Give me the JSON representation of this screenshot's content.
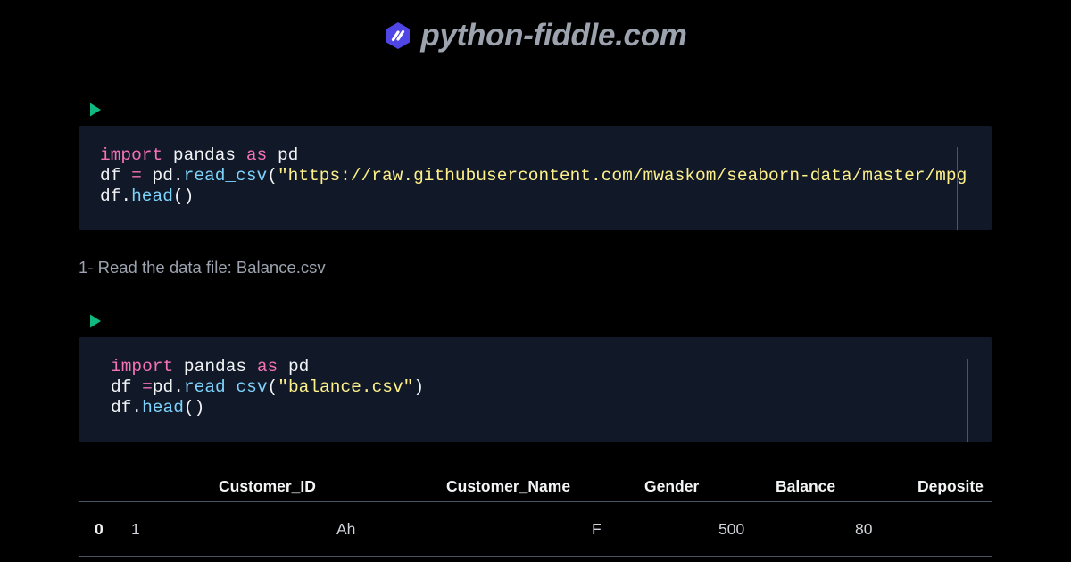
{
  "header": {
    "logo_icon": "python-fiddle-logo-icon",
    "site_name": "python-fiddle.com",
    "logo_color": "#4f46e5"
  },
  "cells": [
    {
      "run_icon": "play-icon",
      "lines": [
        [
          {
            "t": "import",
            "c": "kw"
          },
          {
            "t": " pandas ",
            "c": ""
          },
          {
            "t": "as",
            "c": "kw"
          },
          {
            "t": " pd",
            "c": ""
          }
        ],
        [
          {
            "t": "df ",
            "c": ""
          },
          {
            "t": "=",
            "c": "op"
          },
          {
            "t": " pd.",
            "c": ""
          },
          {
            "t": "read_csv",
            "c": "fn"
          },
          {
            "t": "(",
            "c": ""
          },
          {
            "t": "\"https://raw.githubusercontent.com/mwaskom/seaborn-data/master/mpg",
            "c": "str"
          }
        ],
        [
          {
            "t": "df.",
            "c": ""
          },
          {
            "t": "head",
            "c": "fn"
          },
          {
            "t": "()",
            "c": ""
          }
        ]
      ]
    },
    {
      "run_icon": "play-icon",
      "lines": [
        [
          {
            "t": "import",
            "c": "kw"
          },
          {
            "t": " pandas ",
            "c": ""
          },
          {
            "t": "as",
            "c": "kw"
          },
          {
            "t": " pd",
            "c": ""
          }
        ],
        [
          {
            "t": "df ",
            "c": ""
          },
          {
            "t": "=",
            "c": "op"
          },
          {
            "t": "pd.",
            "c": ""
          },
          {
            "t": "read_csv",
            "c": "fn"
          },
          {
            "t": "(",
            "c": ""
          },
          {
            "t": "\"balance.csv\"",
            "c": "str"
          },
          {
            "t": ")",
            "c": ""
          }
        ],
        [
          {
            "t": "df.",
            "c": ""
          },
          {
            "t": "head",
            "c": "fn"
          },
          {
            "t": "()",
            "c": ""
          }
        ]
      ]
    }
  ],
  "markdown": {
    "text": "1- Read the data file: Balance.csv"
  },
  "table": {
    "columns": [
      "Customer_ID",
      "Customer_Name",
      "Gender",
      "Balance",
      "Deposite"
    ],
    "rows": [
      {
        "index": "0",
        "values": [
          "1",
          "Ah",
          "F",
          "500",
          "80"
        ]
      }
    ]
  },
  "colors": {
    "background": "#000000",
    "cell_bg": "#111827",
    "keyword": "#f472b6",
    "function": "#7dd3fc",
    "string": "#fef08a",
    "run_button": "#10b981",
    "muted_text": "#9ca3af"
  }
}
